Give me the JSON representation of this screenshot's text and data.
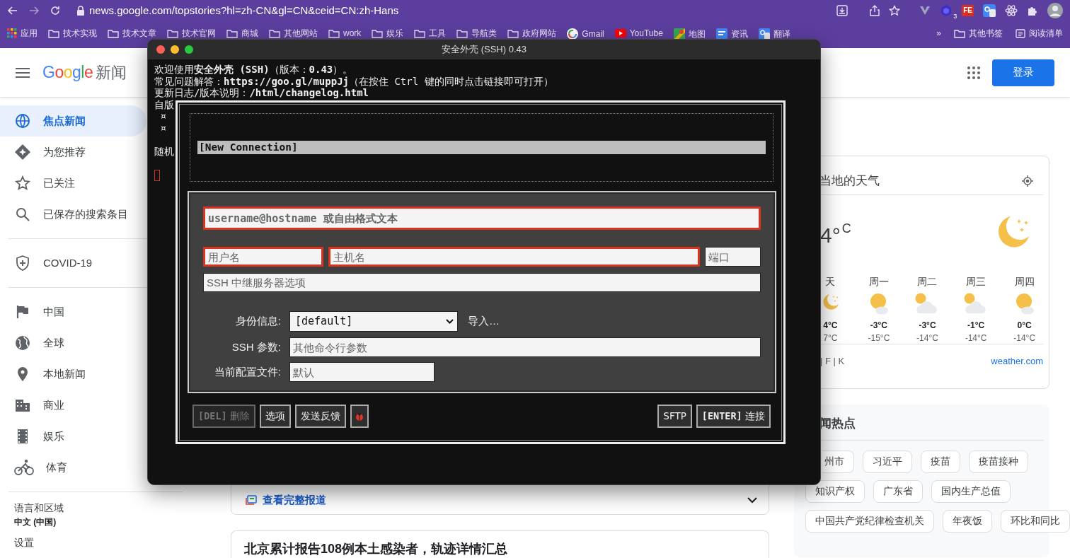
{
  "browser": {
    "url": "news.google.com/topstories?hl=zh-CN&gl=CN&ceid=CN:zh-Hans",
    "extension_badge": "3",
    "extension_label": "FE",
    "bookmarks": [
      {
        "kind": "apps",
        "label": "应用"
      },
      {
        "kind": "folder",
        "label": "技术实现"
      },
      {
        "kind": "folder",
        "label": "技术文章"
      },
      {
        "kind": "folder",
        "label": "技术官网"
      },
      {
        "kind": "folder",
        "label": "商城"
      },
      {
        "kind": "folder",
        "label": "其他网站"
      },
      {
        "kind": "folder",
        "label": "work"
      },
      {
        "kind": "folder",
        "label": "娱乐"
      },
      {
        "kind": "folder",
        "label": "工具"
      },
      {
        "kind": "folder",
        "label": "导航类"
      },
      {
        "kind": "folder",
        "label": "政府网站"
      },
      {
        "kind": "google",
        "label": "Gmail"
      },
      {
        "kind": "youtube",
        "label": "YouTube"
      },
      {
        "kind": "maps",
        "label": "地图"
      },
      {
        "kind": "news",
        "label": "资讯"
      },
      {
        "kind": "translate",
        "label": "翻译"
      }
    ],
    "more": "»",
    "other_bookmarks": "其他书签",
    "reading_list": "阅读清单"
  },
  "news": {
    "logo": "Google",
    "product": "新闻",
    "login": "登录",
    "sidebar": {
      "sections": [
        [
          {
            "kind": "globe",
            "label": "焦点新闻",
            "selected": true
          },
          {
            "kind": "sparkle",
            "label": "为您推荐",
            "selected": false
          },
          {
            "kind": "star",
            "label": "已关注",
            "selected": false
          },
          {
            "kind": "search",
            "label": "已保存的搜索条目",
            "selected": false
          }
        ],
        [
          {
            "kind": "shield",
            "label": "COVID-19",
            "selected": false
          }
        ],
        [
          {
            "kind": "flag",
            "label": "中国",
            "selected": false
          },
          {
            "kind": "earth",
            "label": "全球",
            "selected": false
          },
          {
            "kind": "pin",
            "label": "本地新闻",
            "selected": false
          },
          {
            "kind": "building",
            "label": "商业",
            "selected": false
          },
          {
            "kind": "film",
            "label": "娱乐",
            "selected": false
          },
          {
            "kind": "bike",
            "label": "体育",
            "selected": false
          }
        ]
      ],
      "language_label": "语言和区域",
      "language_value": "中文 (中国)",
      "settings": "设置"
    },
    "full_coverage": "查看完整报道",
    "headline": "北京累计报告108例本土感染者，轨迹详情汇总",
    "weather": {
      "title": "当地的天气",
      "temp": "4°",
      "unit": "C",
      "forecast": [
        {
          "day": "天",
          "kind": "moon",
          "high": "4°C",
          "low": "7°C"
        },
        {
          "day": "周一",
          "kind": "sun_cloud",
          "high": "-3°C",
          "low": "-15°C"
        },
        {
          "day": "周二",
          "kind": "cloud_sun",
          "high": "-3°C",
          "low": "-14°C"
        },
        {
          "day": "周三",
          "kind": "cloud_sun",
          "high": "-1°C",
          "low": "-14°C"
        },
        {
          "day": "周四",
          "kind": "sun_cloud",
          "high": "0°C",
          "low": "-14°C"
        }
      ],
      "units": "| F | K",
      "source": "weather.com"
    },
    "trending": {
      "title": "闻热点",
      "rows": [
        [
          "州市",
          "习近平",
          "疫苗",
          "疫苗接种"
        ],
        [
          "知识产权",
          "广东省",
          "国内生产总值"
        ],
        [
          "中国共产党纪律检查机关",
          "年夜饭",
          "环比和同比"
        ]
      ]
    }
  },
  "terminal": {
    "title": "安全外壳 (SSH) 0.43",
    "lines": [
      {
        "kind": "text",
        "text": "欢迎使用**安全外壳 (SSH)**（版本：**0.43**）。"
      },
      {
        "kind": "text",
        "text": "常见问题解答：**https://goo.gl/muppJj**（在按住 Ctrl 键的同时点击链接即可打开）"
      },
      {
        "kind": "text",
        "text": "更新日志/版本说明：**/html/changelog.html**"
      },
      {
        "kind": "text",
        "text": "自版"
      },
      {
        "kind": "text",
        "text": " ¤"
      },
      {
        "kind": "text",
        "text": " ¤"
      },
      {
        "kind": "blank"
      },
      {
        "kind": "text",
        "text": "随机"
      },
      {
        "kind": "blank"
      },
      {
        "kind": "cursor"
      }
    ],
    "dialog": {
      "connections": [
        {
          "label": "[New Connection]",
          "selected": true
        }
      ],
      "address": {
        "placeholder": "username@hostname 或自由格式文本",
        "invalid": true
      },
      "username": {
        "placeholder": "用户名",
        "invalid": true
      },
      "hostname": {
        "placeholder": "主机名",
        "invalid": true
      },
      "port": {
        "placeholder": "端口",
        "invalid": false
      },
      "relay": {
        "placeholder": "SSH 中继服务器选项"
      },
      "identity": {
        "label": "身份信息:",
        "value": "[default]",
        "import": "导入…"
      },
      "ssh_args": {
        "label": "SSH 参数:",
        "placeholder": "其他命令行参数"
      },
      "profile": {
        "label": "当前配置文件:",
        "placeholder": "默认"
      },
      "left_buttons": [
        {
          "kind": "text",
          "key": "[DEL]",
          "label": "删除",
          "disabled": true
        },
        {
          "kind": "text",
          "label": "选项",
          "disabled": false
        },
        {
          "kind": "text",
          "label": "发送反馈",
          "disabled": false
        },
        {
          "kind": "bug",
          "disabled": false
        }
      ],
      "right_buttons": [
        {
          "kind": "text",
          "label": "SFTP",
          "disabled": false
        },
        {
          "kind": "text",
          "key": "[ENTER]",
          "label": "连接",
          "disabled": false
        }
      ]
    }
  }
}
